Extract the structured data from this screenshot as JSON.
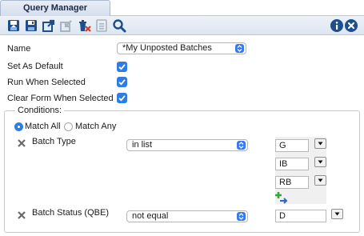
{
  "tab": {
    "label": "Query Manager"
  },
  "toolbar": {
    "icons": [
      "save-down-icon",
      "save-icon",
      "export-icon",
      "import-icon",
      "delete-icon",
      "clear-icon",
      "search-icon",
      "info-icon",
      "close-icon"
    ]
  },
  "form": {
    "name_label": "Name",
    "name_value": "*My Unposted Batches",
    "set_default_label": "Set As Default",
    "set_default_checked": true,
    "run_when_selected_label": "Run When Selected",
    "run_when_selected_checked": true,
    "clear_form_label": "Clear Form When Selected",
    "clear_form_checked": true
  },
  "conditions": {
    "title": "Conditions:",
    "match_all_label": "Match All",
    "match_any_label": "Match Any",
    "match_selected": "all",
    "rows": [
      {
        "field": "Batch Type",
        "operator": "in list",
        "values": [
          "G",
          "IB",
          "RB"
        ]
      },
      {
        "field": "Batch Status (QBE)",
        "operator": "not equal",
        "values": [
          "D"
        ]
      }
    ]
  },
  "colors": {
    "accent": "#2f7de1",
    "toolbar_icon": "#1f4e8c",
    "delete_red": "#d33a2c",
    "add_green": "#3aa53a"
  }
}
